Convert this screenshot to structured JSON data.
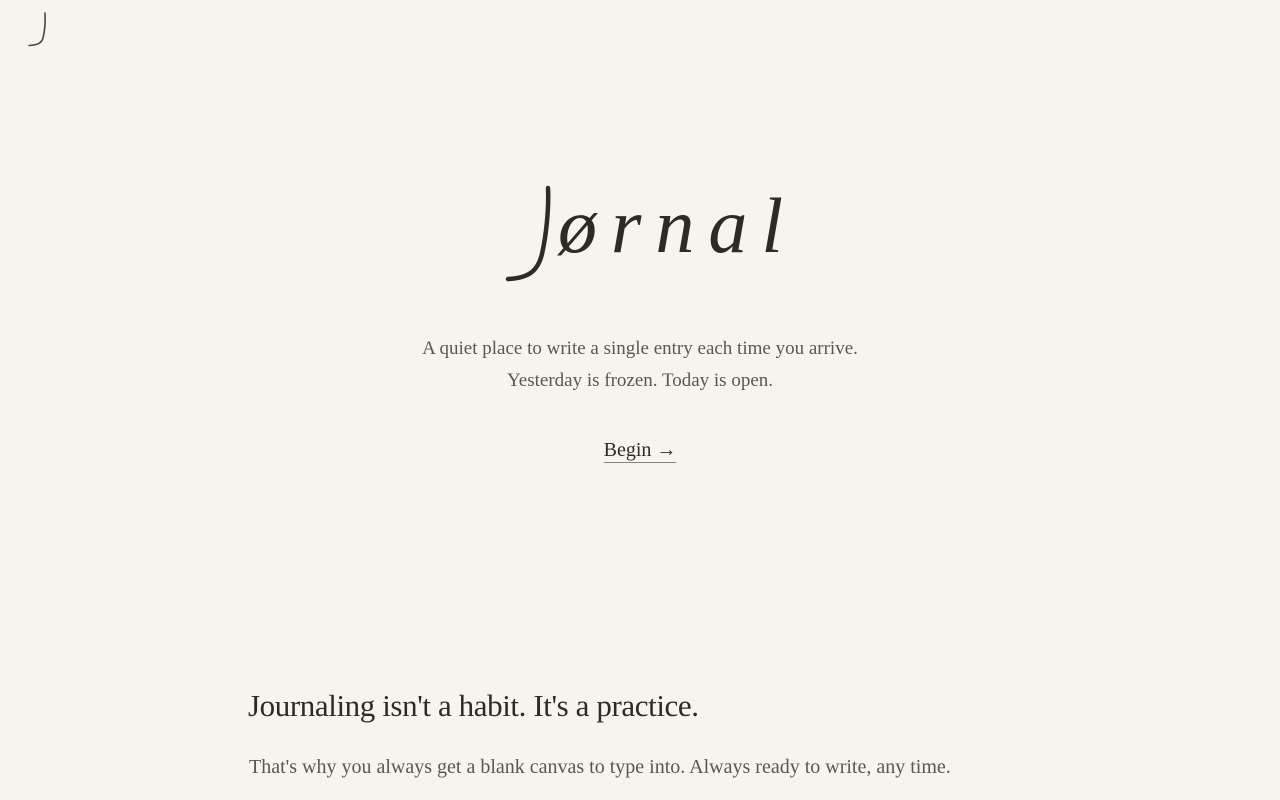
{
  "brand": {
    "corner_logo_icon": "j-monogram-icon",
    "wordmark": "ørnal",
    "wordmark_initial_icon": "script-j-icon"
  },
  "hero": {
    "tagline_line1": "A quiet place to write a single entry each time you arrive.",
    "tagline_line2": "Yesterday is frozen. Today is open.",
    "begin_label": "Begin →"
  },
  "section": {
    "heading": "Journaling isn't a habit. It's a practice.",
    "body": "That's why you always get a blank canvas to type into. Always ready to write, any time."
  },
  "colors": {
    "background": "#f6f4ef",
    "text": "#2f2a26",
    "muted_text": "#5c5650"
  }
}
